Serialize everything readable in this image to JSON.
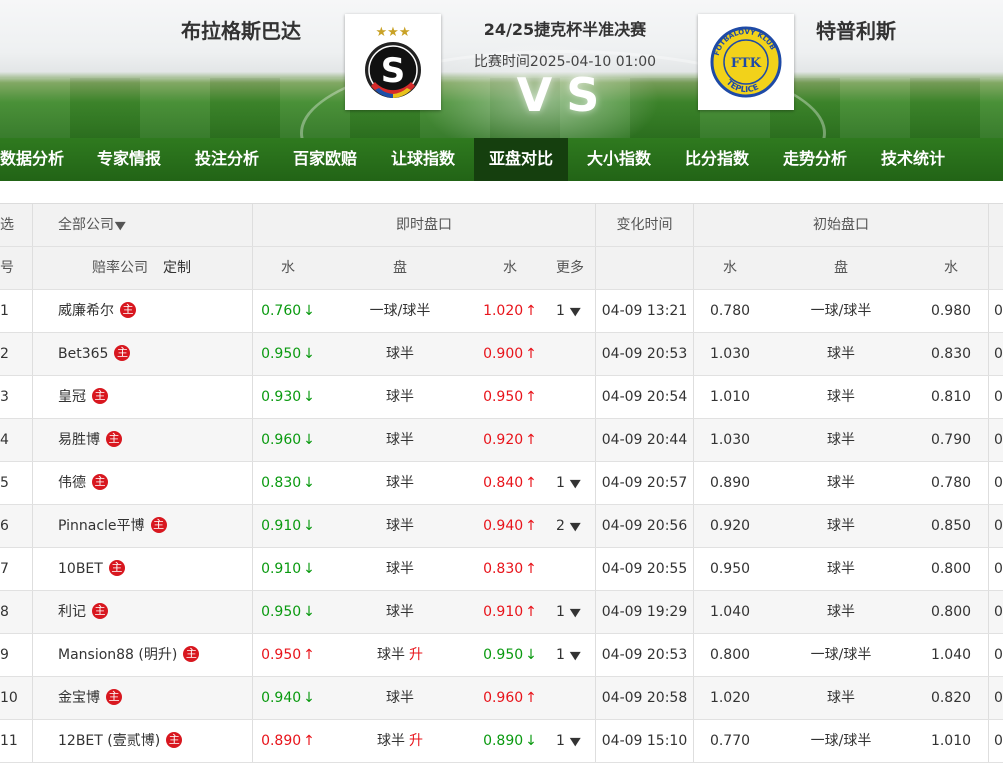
{
  "header": {
    "home_team": "布拉格斯巴达",
    "away_team": "特普利斯",
    "match_title": "24/25捷克杯半准决赛",
    "match_time": "比赛时间2025-04-10 01:00",
    "vs_text": "VS",
    "home_logo": {
      "icon": "sparta-prague-crest",
      "letter": "S",
      "stars": "★★★"
    },
    "away_logo": {
      "icon": "teplice-crest",
      "top_text": "FOTBALOVÝ KLUB",
      "center": "FTK",
      "bottom_text": "TEPLICE"
    }
  },
  "nav": {
    "items": [
      "数据分析",
      "专家情报",
      "投注分析",
      "百家欧赔",
      "让球指数",
      "亚盘对比",
      "大小指数",
      "比分指数",
      "走势分析",
      "技术统计"
    ],
    "active": "亚盘对比"
  },
  "table": {
    "header_row1": {
      "select": "选",
      "company_filter": "全部公司",
      "live": "即时盘口",
      "change_time": "变化时间",
      "initial": "初始盘口"
    },
    "header_row2": {
      "num": "号",
      "company": "赔率公司",
      "customize": "定制",
      "water": "水",
      "handicap": "盘",
      "water2": "水",
      "more": "更多",
      "init_water": "水",
      "init_handicap": "盘",
      "init_water2": "水"
    },
    "main_badge": "主",
    "rise_tag": "升",
    "rows": [
      {
        "no": "1",
        "company": "威廉希尔",
        "w1": "0.760",
        "w1_dir": "down",
        "pan": "一球/球半",
        "pan_up": false,
        "w2": "1.020",
        "w2_dir": "up",
        "more": "1",
        "time": "04-09 13:21",
        "iw1": "0.780",
        "ipan": "一球/球半",
        "iw2": "0.980",
        "extra": "0"
      },
      {
        "no": "2",
        "company": "Bet365",
        "w1": "0.950",
        "w1_dir": "down",
        "pan": "球半",
        "pan_up": false,
        "w2": "0.900",
        "w2_dir": "up",
        "more": "",
        "time": "04-09 20:53",
        "iw1": "1.030",
        "ipan": "球半",
        "iw2": "0.830",
        "extra": "0"
      },
      {
        "no": "3",
        "company": "皇冠",
        "w1": "0.930",
        "w1_dir": "down",
        "pan": "球半",
        "pan_up": false,
        "w2": "0.950",
        "w2_dir": "up",
        "more": "",
        "time": "04-09 20:54",
        "iw1": "1.010",
        "ipan": "球半",
        "iw2": "0.810",
        "extra": "0"
      },
      {
        "no": "4",
        "company": "易胜博",
        "w1": "0.960",
        "w1_dir": "down",
        "pan": "球半",
        "pan_up": false,
        "w2": "0.920",
        "w2_dir": "up",
        "more": "",
        "time": "04-09 20:44",
        "iw1": "1.030",
        "ipan": "球半",
        "iw2": "0.790",
        "extra": "0"
      },
      {
        "no": "5",
        "company": "伟德",
        "w1": "0.830",
        "w1_dir": "down",
        "pan": "球半",
        "pan_up": false,
        "w2": "0.840",
        "w2_dir": "up",
        "more": "1",
        "time": "04-09 20:57",
        "iw1": "0.890",
        "ipan": "球半",
        "iw2": "0.780",
        "extra": "0"
      },
      {
        "no": "6",
        "company": "Pinnacle平博",
        "w1": "0.910",
        "w1_dir": "down",
        "pan": "球半",
        "pan_up": false,
        "w2": "0.940",
        "w2_dir": "up",
        "more": "2",
        "time": "04-09 20:56",
        "iw1": "0.920",
        "ipan": "球半",
        "iw2": "0.850",
        "extra": "0"
      },
      {
        "no": "7",
        "company": "10BET",
        "w1": "0.910",
        "w1_dir": "down",
        "pan": "球半",
        "pan_up": false,
        "w2": "0.830",
        "w2_dir": "up",
        "more": "",
        "time": "04-09 20:55",
        "iw1": "0.950",
        "ipan": "球半",
        "iw2": "0.800",
        "extra": "0"
      },
      {
        "no": "8",
        "company": "利记",
        "w1": "0.950",
        "w1_dir": "down",
        "pan": "球半",
        "pan_up": false,
        "w2": "0.910",
        "w2_dir": "up",
        "more": "1",
        "time": "04-09 19:29",
        "iw1": "1.040",
        "ipan": "球半",
        "iw2": "0.800",
        "extra": "0"
      },
      {
        "no": "9",
        "company": "Mansion88 (明升)",
        "w1": "0.950",
        "w1_dir": "up",
        "pan": "球半",
        "pan_up": true,
        "w2": "0.950",
        "w2_dir": "down",
        "more": "1",
        "time": "04-09 20:53",
        "iw1": "0.800",
        "ipan": "一球/球半",
        "iw2": "1.040",
        "extra": "0"
      },
      {
        "no": "10",
        "company": "金宝博",
        "w1": "0.940",
        "w1_dir": "down",
        "pan": "球半",
        "pan_up": false,
        "w2": "0.960",
        "w2_dir": "up",
        "more": "",
        "time": "04-09 20:58",
        "iw1": "1.020",
        "ipan": "球半",
        "iw2": "0.820",
        "extra": "0"
      },
      {
        "no": "11",
        "company": "12BET (壹贰博)",
        "w1": "0.890",
        "w1_dir": "up",
        "pan": "球半",
        "pan_up": true,
        "w2": "0.890",
        "w2_dir": "down",
        "more": "1",
        "time": "04-09 15:10",
        "iw1": "0.770",
        "ipan": "一球/球半",
        "iw2": "1.010",
        "extra": "0"
      }
    ]
  }
}
